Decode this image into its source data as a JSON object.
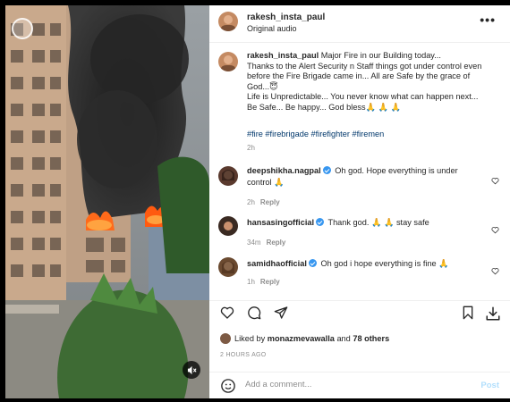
{
  "post": {
    "username": "rakesh_insta_paul",
    "audio": "Original audio",
    "more": "•••"
  },
  "caption": {
    "username": "rakesh_insta_paul",
    "lines": [
      "Major Fire in our Building today...",
      "Thanks to the Alert Security n Staff things got under control even",
      "before the Fire Brigade came in... All are Safe by the grace of",
      "God...😇",
      "Life is Unpredictable... You never know what can happen next...",
      "Be Safe... Be happy... God bless🙏 🙏 🙏"
    ],
    "hashtags": "#fire #firebrigade #firefighter #firemen",
    "time": "2h"
  },
  "comments": [
    {
      "username": "deepshikha.nagpal",
      "text_line1": "Oh god. Hope everything is under",
      "text_line2": "control 🙏",
      "time": "2h",
      "reply": "Reply"
    },
    {
      "username": "hansasingofficial",
      "text_line1": "Thank god. 🙏 🙏 stay safe",
      "text_line2": "",
      "time": "34m",
      "reply": "Reply"
    },
    {
      "username": "samidhaofficial",
      "text_line1": "Oh god i hope everything is fine 🙏",
      "text_line2": "",
      "time": "1h",
      "reply": "Reply"
    }
  ],
  "likes": {
    "prefix": "Liked by",
    "user": "monazmevawalla",
    "and": "and",
    "others": "78 others"
  },
  "ago": "2 HOURS AGO",
  "comment_box": {
    "placeholder": "Add a comment...",
    "post_label": "Post"
  },
  "icons": {
    "like": "heart-icon",
    "comment": "comment-icon",
    "share": "share-icon",
    "save": "bookmark-icon",
    "download": "download-icon",
    "emoji": "emoji-icon",
    "mute": "speaker-muted-icon",
    "logo": "reel-logo-icon"
  },
  "colors": {
    "link": "#00376b",
    "verified": "#3897f0",
    "post_disabled": "#b2dffc",
    "muted_text": "#8e8e8e"
  }
}
